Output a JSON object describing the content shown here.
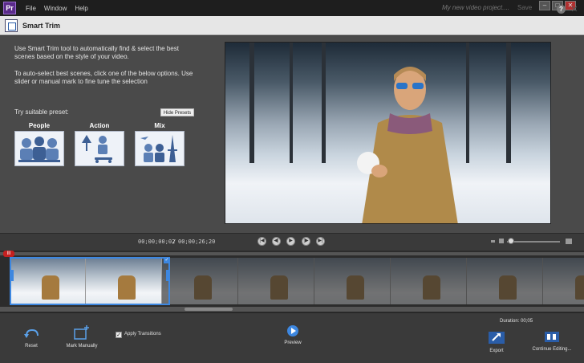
{
  "menubar": {
    "logo_glyph": "Pr",
    "items": [
      "File",
      "Window",
      "Help"
    ],
    "project_title": "My new video project....",
    "save": "Save"
  },
  "window_buttons": [
    "–",
    "□",
    "✕"
  ],
  "titlebar": {
    "title": "Smart Trim",
    "help": "?",
    "close": "✕"
  },
  "instructions": {
    "line1a": "Use Smart Trim tool to automatically find & select the best",
    "line1b": "scenes based on the style of your video.",
    "line2a": "To auto-select best scenes, click one of the below options. Use",
    "line2b": "slider or manual mark to fine tune the selection"
  },
  "presets": {
    "label": "Try suitable preset:",
    "hide_button": "Hide Presets",
    "items": [
      {
        "name": "People",
        "icon": "people-icon"
      },
      {
        "name": "Action",
        "icon": "action-icon"
      },
      {
        "name": "Mix",
        "icon": "mix-icon"
      }
    ]
  },
  "playback": {
    "current_time": "00;00;00;02",
    "separator": "/",
    "total_time": "00;00;26;20",
    "buttons": [
      "skip-back-icon",
      "step-back-icon",
      "play-icon",
      "step-forward-icon",
      "skip-forward-icon"
    ],
    "zoom_level": 0.08
  },
  "timeline": {
    "marker_label": "III",
    "frames": 8,
    "selected_frames": 2
  },
  "bottom": {
    "reset": "Reset",
    "mark_manually": "Mark Manually",
    "apply_transitions": "Apply Transitions",
    "apply_transitions_checked": true,
    "preview": "Preview",
    "duration": "Duration: 00;05",
    "export": "Export",
    "continue_editing": "Continue Editing..."
  },
  "colors": {
    "accent": "#3d87e0",
    "marker": "#c42020"
  }
}
